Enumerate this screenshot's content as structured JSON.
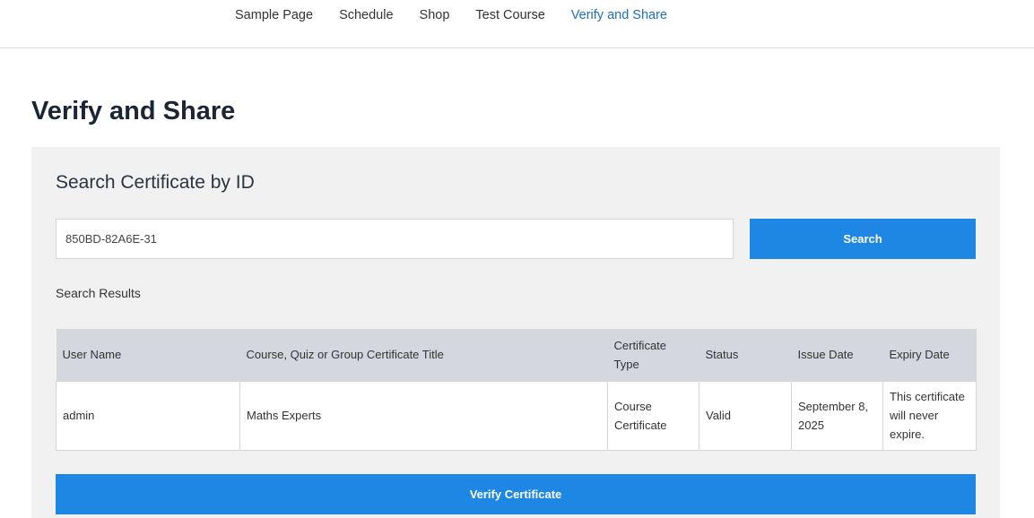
{
  "nav": {
    "items": [
      {
        "label": "Sample Page",
        "active": false
      },
      {
        "label": "Schedule",
        "active": false
      },
      {
        "label": "Shop",
        "active": false
      },
      {
        "label": "Test Course",
        "active": false
      },
      {
        "label": "Verify and Share",
        "active": true
      }
    ]
  },
  "page": {
    "title": "Verify and Share"
  },
  "search": {
    "heading": "Search Certificate by ID",
    "value": "850BD-82A6E-31",
    "button_label": "Search"
  },
  "results": {
    "label": "Search Results",
    "columns": [
      "User Name",
      "Course, Quiz or Group Certificate Title",
      "Certificate Type",
      "Status",
      "Issue Date",
      "Expiry Date"
    ],
    "rows": [
      {
        "user_name": "admin",
        "title": "Maths Experts",
        "type": "Course Certificate",
        "status": "Valid",
        "issue_date": "September 8, 2025",
        "expiry_date": "This certificate will never expire."
      }
    ]
  },
  "verify": {
    "button_label": "Verify Certificate"
  },
  "colors": {
    "accent": "#1e87e4",
    "active_nav": "#1e6fb8",
    "panel_bg": "#f1f1f1",
    "table_header_bg": "#d4d7de"
  }
}
